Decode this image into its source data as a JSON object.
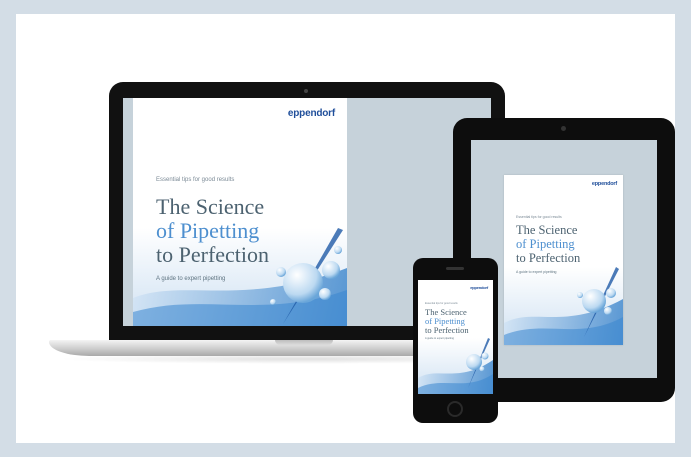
{
  "devices": {
    "laptop": {
      "name": "laptop"
    },
    "tablet": {
      "name": "tablet"
    },
    "phone": {
      "name": "smartphone"
    }
  },
  "cover": {
    "brand": "eppendorf",
    "tagline": "Essential tips for good results",
    "title_line1": "The Science",
    "title_line2": "of Pipetting",
    "title_line3": "to Perfection",
    "subtitle": "A guide to expert pipetting"
  },
  "colors": {
    "background": "#d3dde6",
    "brand_blue": "#1f4e9a",
    "title_dark": "#4c6270",
    "title_blue": "#4d8fcf"
  }
}
